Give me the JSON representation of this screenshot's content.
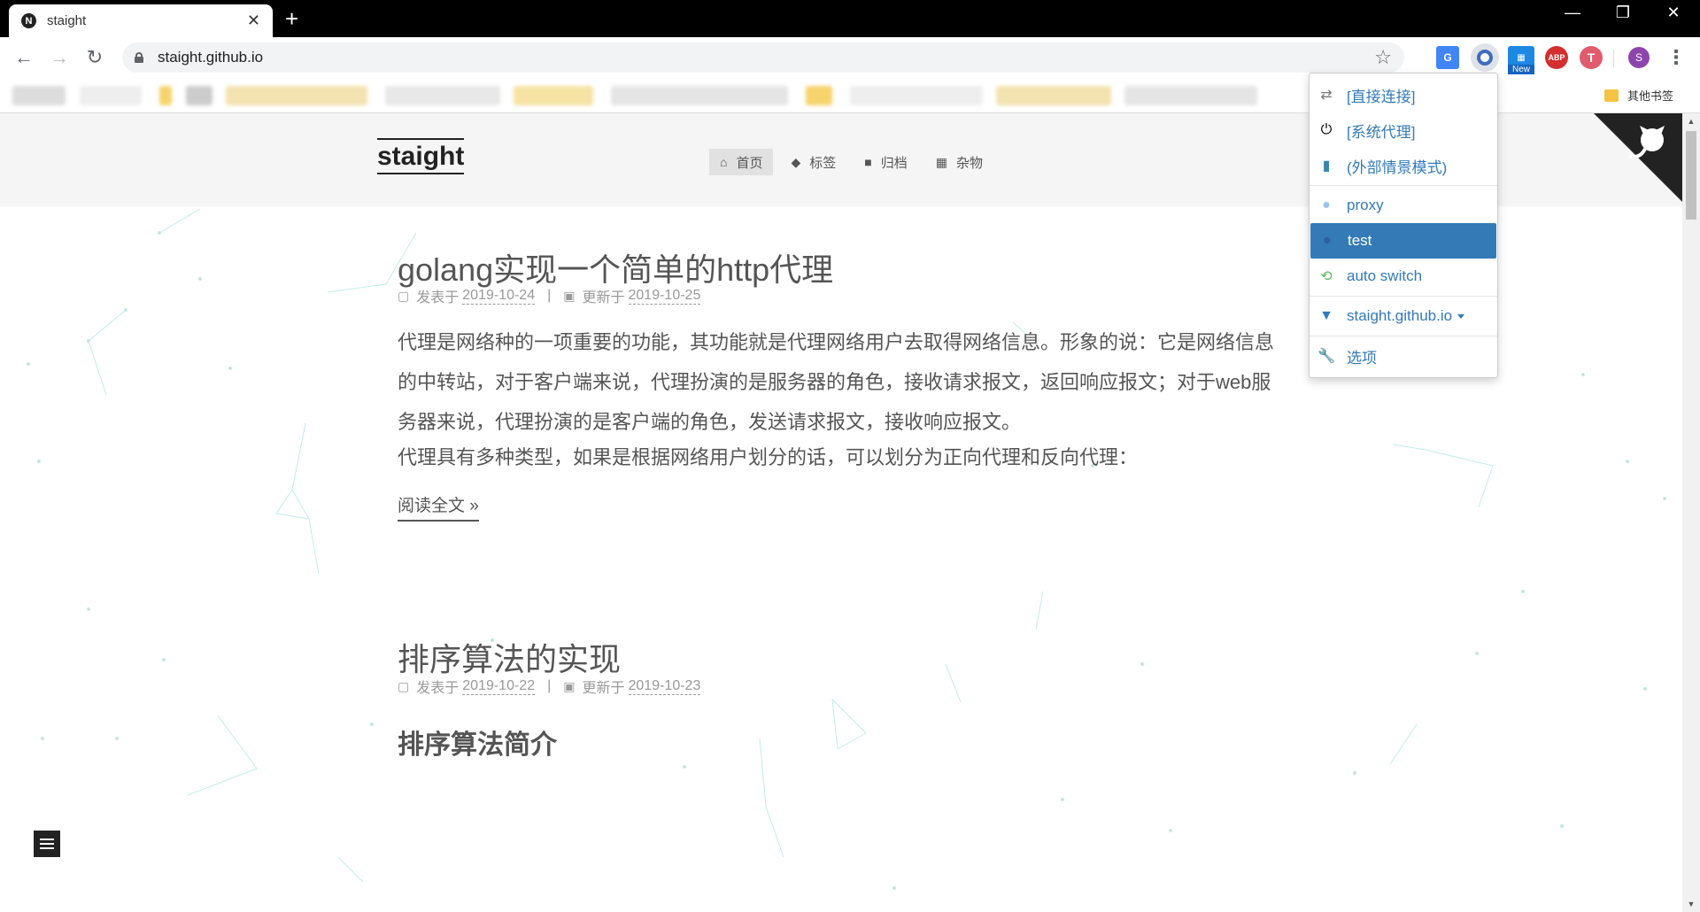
{
  "browser": {
    "tab_title": "staight",
    "tab_favicon": "N",
    "new_tab": "+",
    "url": "staight.github.io",
    "window_controls": [
      "—",
      "❐",
      "✕"
    ],
    "extensions": {
      "new_badge": "New",
      "abp": "ABP",
      "t_icon": "T",
      "profile": "S"
    },
    "other_bookmarks": "其他书签"
  },
  "site": {
    "logo": "staight",
    "menu": [
      {
        "label": "首页",
        "icon": "home-icon",
        "active": true
      },
      {
        "label": "标签",
        "icon": "tags-icon"
      },
      {
        "label": "归档",
        "icon": "archive-icon"
      },
      {
        "label": "杂物",
        "icon": "calendar-icon"
      }
    ]
  },
  "posts": [
    {
      "title": "golang实现一个简单的http代理",
      "published_label": "发表于",
      "published": "2019-10-24",
      "separator": "|",
      "updated_label": "更新于",
      "updated": "2019-10-25",
      "paragraphs": [
        "代理是网络种的一项重要的功能，其功能就是代理网络用户去取得网络信息。形象的说：它是网络信息的中转站，对于客户端来说，代理扮演的是服务器的角色，接收请求报文，返回响应报文；对于web服务器来说，代理扮演的是客户端的角色，发送请求报文，接收响应报文。",
        "代理具有多种类型，如果是根据网络用户划分的话，可以划分为正向代理和反向代理："
      ],
      "read_more": "阅读全文 »"
    },
    {
      "title": "排序算法的实现",
      "published_label": "发表于",
      "published": "2019-10-22",
      "separator": "|",
      "updated_label": "更新于",
      "updated": "2019-10-23",
      "h2": "排序算法简介"
    }
  ],
  "proxy_popup": {
    "items": [
      {
        "label": "[直接连接]",
        "icon": "transfer-icon"
      },
      {
        "label": "[系统代理]",
        "icon": "power-icon"
      },
      {
        "label": "(外部情景模式)",
        "icon": "file-icon"
      },
      {
        "label": "proxy",
        "icon": "globe-icon"
      },
      {
        "label": "test",
        "icon": "globe-icon",
        "active": true
      },
      {
        "label": "auto switch",
        "icon": "retweet-icon"
      },
      {
        "label": "staight.github.io",
        "icon": "filter-icon"
      },
      {
        "label": "选项",
        "icon": "wrench-icon"
      }
    ]
  },
  "colors": {
    "accent": "#337ab7",
    "header_bg": "#f5f5f5",
    "text": "#555555"
  }
}
